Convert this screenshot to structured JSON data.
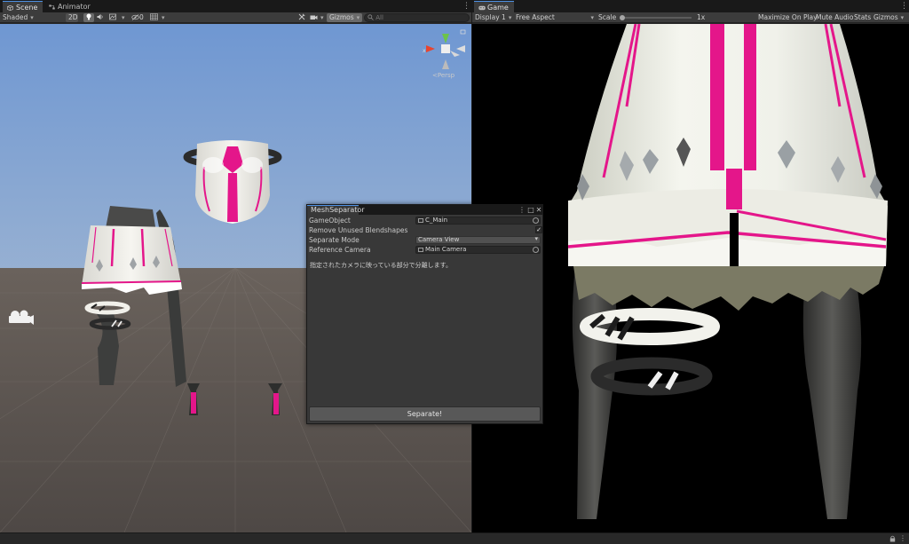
{
  "scene_panel": {
    "tabs": [
      {
        "label": "Scene",
        "icon": "scene-icon"
      },
      {
        "label": "Animator",
        "icon": "animator-icon"
      }
    ],
    "toolbar": {
      "shading_mode": "Shaded",
      "mode_2d": "2D",
      "hidden_count": "0",
      "gizmos": "Gizmos",
      "search_placeholder": "All"
    },
    "view_orientation": "Persp"
  },
  "game_panel": {
    "tab_label": "Game",
    "toolbar": {
      "display": "Display 1",
      "aspect": "Free Aspect",
      "scale_label": "Scale",
      "scale_value": "1x",
      "scale_fraction": 0.0,
      "maximize": "Maximize On Play",
      "mute": "Mute Audio",
      "stats": "Stats",
      "gizmos": "Gizmos"
    }
  },
  "mesh_separator": {
    "title": "MeshSeparator",
    "fields": {
      "game_object_label": "GameObject",
      "game_object_value": "C_Main",
      "remove_blendshapes_label": "Remove Unused Blendshapes",
      "remove_blendshapes_checked": true,
      "separate_mode_label": "Separate Mode",
      "separate_mode_value": "Camera View",
      "reference_camera_label": "Reference Camera",
      "reference_camera_value": "Main Camera"
    },
    "description": "指定されたカメラに映っている部分で分離します。",
    "check_mark": "✓",
    "separate_button": "Separate!"
  },
  "colors": {
    "sky_top": "#6f97d2",
    "ground": "#57504d",
    "accent_pink": "#e4168a",
    "garment_white": "#ecebe4",
    "editor_bg": "#282828",
    "selection_blue": "#4d91e5"
  },
  "icons": {
    "kebab": "⋮",
    "maximize": "□",
    "close": "✕"
  }
}
